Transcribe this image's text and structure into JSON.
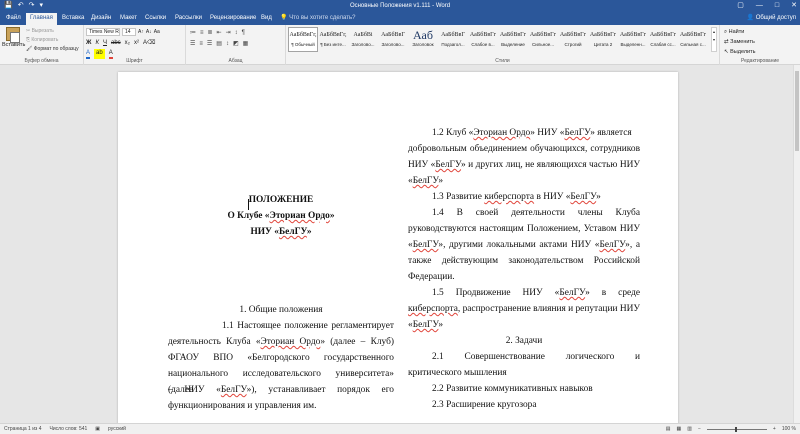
{
  "window": {
    "title": "Основные Положения v1.111 - Word",
    "controls": [
      "▢",
      "—",
      "□",
      "✕"
    ]
  },
  "qat": {
    "save": "💾",
    "undo": "↶",
    "redo": "↷",
    "more": "▾"
  },
  "tabs": [
    "Файл",
    "Главная",
    "Вставка",
    "Дизайн",
    "Макет",
    "Ссылки",
    "Рассылки",
    "Рецензирование",
    "Вид"
  ],
  "active_tab": "Главная",
  "tell_me": "Что вы хотите сделать?",
  "share": "Общий доступ",
  "ribbon": {
    "clipboard": {
      "paste": "Вставить",
      "cut": "Вырезать",
      "copy": "Копировать",
      "format_painter": "Формат по образцу",
      "label": "Буфер обмена"
    },
    "font": {
      "name": "Times New R",
      "size": "14",
      "label": "Шрифт",
      "bold": "Ж",
      "italic": "К",
      "underline": "Ч",
      "strike": "abc",
      "sub": "x₂",
      "sup": "x²",
      "grow": "A↑",
      "shrink": "A↓",
      "case": "Aa",
      "clear": "A⌫",
      "color": "A"
    },
    "paragraph": {
      "label": "Абзац",
      "icons": [
        "≔",
        "≡",
        "≣",
        "⇤",
        "⇥",
        "↕",
        "¶"
      ]
    },
    "styles": {
      "label": "Стили",
      "items": [
        {
          "preview": "АаБбВвГг,",
          "name": "¶ Обычный",
          "selected": true
        },
        {
          "preview": "АаБбВвГг,",
          "name": "¶ Без инте..."
        },
        {
          "preview": "АаБбВі",
          "name": "Заголово..."
        },
        {
          "preview": "АаБбВвГ",
          "name": "Заголово..."
        },
        {
          "preview": "Ааб",
          "name": "Заголовок",
          "big": true
        },
        {
          "preview": "АаБбВвГ",
          "name": "Подзагол..."
        },
        {
          "preview": "АаБбВвГг",
          "name": "Слабое в..."
        },
        {
          "preview": "АаБбВвГг",
          "name": "Выделение"
        },
        {
          "preview": "АаБбВвГг",
          "name": "Сильное..."
        },
        {
          "preview": "АаБбВвГг",
          "name": "Строгий"
        },
        {
          "preview": "АаБбВвГг",
          "name": "Цитата 2"
        },
        {
          "preview": "АаБбВвГг",
          "name": "Выделенн..."
        },
        {
          "preview": "АаБбВвГг",
          "name": "Слабая сс..."
        },
        {
          "preview": "АаБбВвГг",
          "name": "Сильная с..."
        }
      ]
    },
    "editing": {
      "find": "Найти",
      "replace": "Заменить",
      "select": "Выделить",
      "label": "Редактирование"
    }
  },
  "document": {
    "title_lines": [
      {
        "parts": [
          {
            "t": "ПОЛОЖЕНИЕ"
          }
        ]
      },
      {
        "parts": [
          {
            "t": "О Клубе «"
          },
          {
            "t": "Эториан Ордо",
            "u": true
          },
          {
            "t": "»"
          }
        ]
      },
      {
        "parts": [
          {
            "t": "НИУ «"
          },
          {
            "t": "БелГУ",
            "u": true
          },
          {
            "t": "»"
          }
        ]
      }
    ],
    "left_lines": [
      {
        "parts": [
          {
            "t": "1.        Общие положения"
          }
        ],
        "mode": "center"
      },
      {
        "parts": [
          {
            "t": "1.1  Настоящее  положение  регламентирует"
          }
        ],
        "mode": "just",
        "indent": 54
      },
      {
        "parts": [
          {
            "t": "деятельность  Клуба  «"
          },
          {
            "t": "Эториан Ордо",
            "u": true
          },
          {
            "t": "»  (далее  –  Клуб)"
          }
        ],
        "mode": "just"
      },
      {
        "parts": [
          {
            "t": "ФГАОУ  ВПО  «Белгородского  государственного"
          }
        ],
        "mode": "just"
      },
      {
        "parts": [
          {
            "t": "национального исследовательского университета» (далее"
          }
        ],
        "mode": "just"
      },
      {
        "parts": [
          {
            "t": "–  НИУ  «"
          },
          {
            "t": "БелГУ",
            "u": true
          },
          {
            "t": "»),  устанавливает  порядок  его"
          }
        ],
        "mode": "just"
      },
      {
        "parts": [
          {
            "t": "функционирования и управления им."
          }
        ],
        "mode": "left"
      }
    ],
    "right_lines": [
      {
        "parts": [
          {
            "t": "1.2      Клуб «"
          },
          {
            "t": "Эториан Ордо",
            "u": true
          },
          {
            "t": "» НИУ «"
          },
          {
            "t": "БелГУ",
            "u": true
          },
          {
            "t": "» является"
          }
        ],
        "mode": "left",
        "indent": 24
      },
      {
        "parts": [
          {
            "t": "добровольным объединением обучающихся, сотрудников"
          }
        ],
        "mode": "just"
      },
      {
        "parts": [
          {
            "t": "НИУ «"
          },
          {
            "t": "БелГУ",
            "u": true
          },
          {
            "t": "» и других лиц, не являющихся частью НИУ"
          }
        ],
        "mode": "just"
      },
      {
        "parts": [
          {
            "t": "«"
          },
          {
            "t": "БелГУ",
            "u": true
          },
          {
            "t": "»"
          }
        ],
        "mode": "left"
      },
      {
        "parts": [
          {
            "t": "1.3      Развитие "
          },
          {
            "t": "киберспорта",
            "u": true
          },
          {
            "t": " в НИУ «"
          },
          {
            "t": "БелГУ",
            "u": true
          },
          {
            "t": "»"
          }
        ],
        "mode": "left",
        "indent": 24
      },
      {
        "parts": [
          {
            "t": "1.4  В  своей  деятельности  члены  Клуба"
          }
        ],
        "mode": "just",
        "indent": 24
      },
      {
        "parts": [
          {
            "t": "руководствуются настоящим Положением, Уставом НИУ"
          }
        ],
        "mode": "just"
      },
      {
        "parts": [
          {
            "t": "«"
          },
          {
            "t": "БелГУ",
            "u": true
          },
          {
            "t": "»,  другими  локальными  актами  НИУ  «"
          },
          {
            "t": "БелГУ",
            "u": true
          },
          {
            "t": "»,  а"
          }
        ],
        "mode": "just"
      },
      {
        "parts": [
          {
            "t": "также    действующим    законодательством    Российской"
          }
        ],
        "mode": "just"
      },
      {
        "parts": [
          {
            "t": "Федерации."
          }
        ],
        "mode": "left"
      },
      {
        "parts": [
          {
            "t": "1.5  Продвижение  НИУ  «"
          },
          {
            "t": "БелГУ",
            "u": true
          },
          {
            "t": "»  в  среде"
          }
        ],
        "mode": "just",
        "indent": 24
      },
      {
        "parts": [
          {
            "t": "киберспорта",
            "u": true
          },
          {
            "t": ", распространение влияния и репутации НИУ"
          }
        ],
        "mode": "just"
      },
      {
        "parts": [
          {
            "t": "«"
          },
          {
            "t": "БелГУ",
            "u": true
          },
          {
            "t": "»"
          }
        ],
        "mode": "left"
      },
      {
        "parts": [
          {
            "t": "2.        Задачи"
          }
        ],
        "mode": "center"
      },
      {
        "parts": [
          {
            "t": "2.1      Совершенствование        логического        и"
          }
        ],
        "mode": "just",
        "indent": 24
      },
      {
        "parts": [
          {
            "t": "критического мышления"
          }
        ],
        "mode": "left"
      },
      {
        "parts": [
          {
            "t": "2.2      Развитие коммуникативных навыков"
          }
        ],
        "mode": "left",
        "indent": 24
      },
      {
        "parts": [
          {
            "t": "2.3      Расширение кругозора"
          }
        ],
        "mode": "left",
        "indent": 24
      }
    ]
  },
  "status": {
    "page": "Страница 1 из 4",
    "words": "Число слов: 541",
    "proofing": "▣",
    "lang": "русский",
    "zoom": "100 %",
    "view_icons": [
      "▤",
      "▦",
      "▥"
    ],
    "zoom_minus": "−",
    "zoom_plus": "+"
  }
}
